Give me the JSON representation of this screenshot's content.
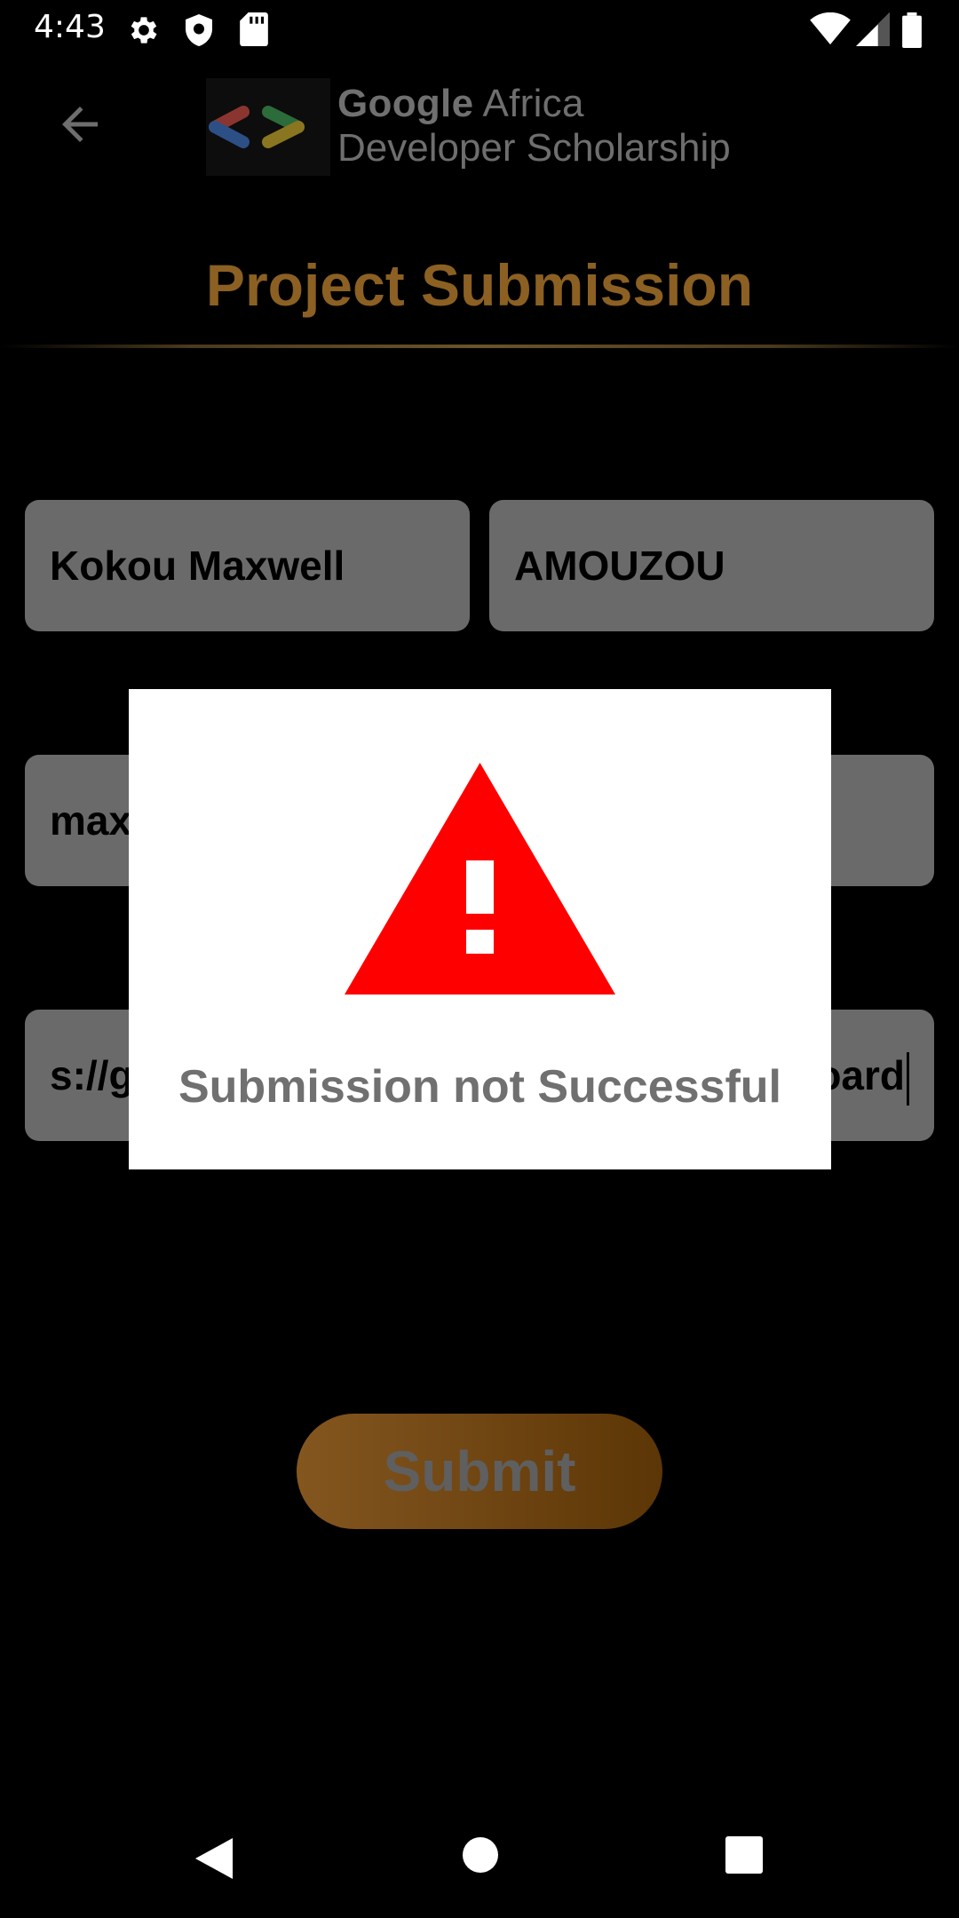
{
  "status_bar": {
    "time": "4:43",
    "icons": [
      "settings-icon",
      "shield-icon",
      "sd-card-icon",
      "wifi-icon",
      "cellular-icon",
      "battery-icon"
    ]
  },
  "app_bar": {
    "brand_line1_bold": "Google",
    "brand_line1_rest": " Africa",
    "brand_line2": "Developer Scholarship"
  },
  "page": {
    "title": "Project Submission"
  },
  "form": {
    "first_name": "Kokou Maxwell",
    "last_name": "AMOUZOU",
    "email_visible": "max",
    "link_visible_start": "s://g",
    "link_visible_end": "oard"
  },
  "submit": {
    "label": "Submit"
  },
  "dialog": {
    "message": "Submission not Successful"
  },
  "colors": {
    "title": "#8b6022",
    "button_start": "#84561f",
    "button_end": "#5c3606",
    "warning": "#ff0000",
    "field_bg": "#6a6a6a"
  }
}
